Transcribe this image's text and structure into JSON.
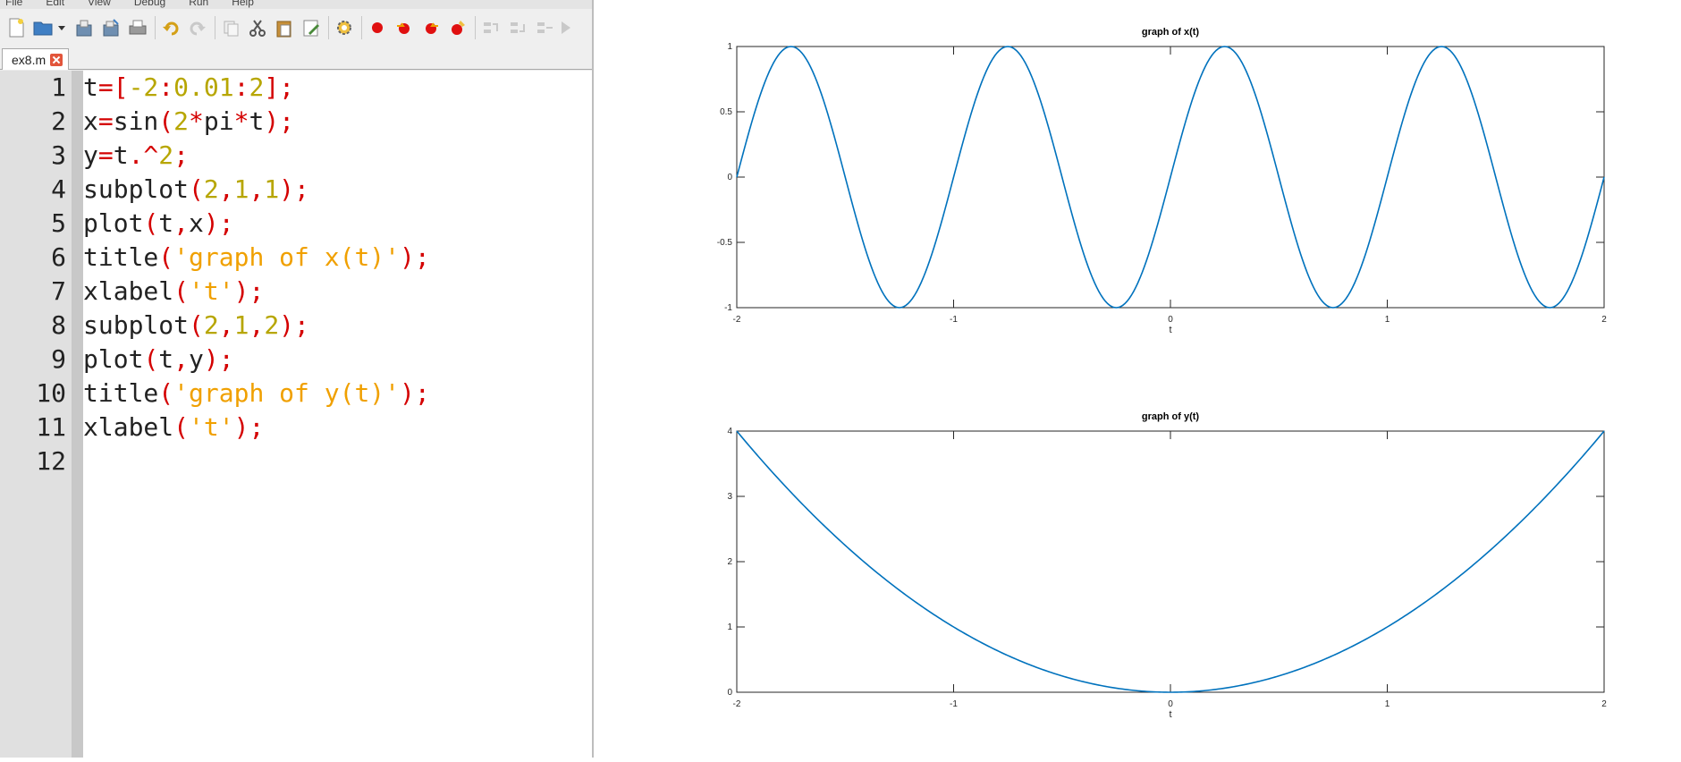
{
  "menubar": {
    "items": [
      "File",
      "Edit",
      "View",
      "Debug",
      "Run",
      "Help"
    ]
  },
  "toolbar": {
    "icons": [
      "new-file-icon",
      "open-folder-icon",
      "dropdown-arrow-icon",
      "save-icon",
      "save-as-icon",
      "print-icon",
      "undo-icon",
      "redo-icon",
      "copy-icon",
      "cut-icon",
      "paste-icon",
      "edit-icon",
      "settings-icon",
      "breakpoint-icon",
      "breakpoint-next-icon",
      "breakpoint-prev-icon",
      "clear-breakpoints-icon",
      "step-icon",
      "step-in-icon",
      "step-out-icon",
      "run-icon"
    ]
  },
  "tab": {
    "label": "ex8.m"
  },
  "code": {
    "lines": [
      [
        [
          "t",
          "id"
        ],
        [
          "=[",
          "op"
        ],
        [
          "-2",
          "num"
        ],
        [
          ":",
          "op"
        ],
        [
          "0.01",
          "num"
        ],
        [
          ":",
          "op"
        ],
        [
          "2",
          "num"
        ],
        [
          "];",
          "op"
        ]
      ],
      [
        [
          "x",
          "id"
        ],
        [
          "=",
          "op"
        ],
        [
          "sin",
          "id"
        ],
        [
          "(",
          "op"
        ],
        [
          "2",
          "num"
        ],
        [
          "*",
          "op"
        ],
        [
          "pi",
          "id"
        ],
        [
          "*",
          "op"
        ],
        [
          "t",
          "id"
        ],
        [
          ");",
          "op"
        ]
      ],
      [
        [
          "y",
          "id"
        ],
        [
          "=",
          "op"
        ],
        [
          "t",
          "id"
        ],
        [
          ".^",
          "op"
        ],
        [
          "2",
          "num"
        ],
        [
          ";",
          "op"
        ]
      ],
      [
        [
          "subplot",
          "id"
        ],
        [
          "(",
          "op"
        ],
        [
          "2",
          "num"
        ],
        [
          ",",
          "op"
        ],
        [
          "1",
          "num"
        ],
        [
          ",",
          "op"
        ],
        [
          "1",
          "num"
        ],
        [
          ");",
          "op"
        ]
      ],
      [
        [
          "plot",
          "id"
        ],
        [
          "(",
          "op"
        ],
        [
          "t",
          "id"
        ],
        [
          ",",
          "op"
        ],
        [
          "x",
          "id"
        ],
        [
          ");",
          "op"
        ]
      ],
      [
        [
          "title",
          "id"
        ],
        [
          "(",
          "op"
        ],
        [
          "'graph of x(t)'",
          "str"
        ],
        [
          ");",
          "op"
        ]
      ],
      [
        [
          "xlabel",
          "id"
        ],
        [
          "(",
          "op"
        ],
        [
          "'t'",
          "str"
        ],
        [
          ");",
          "op"
        ]
      ],
      [
        [
          "subplot",
          "id"
        ],
        [
          "(",
          "op"
        ],
        [
          "2",
          "num"
        ],
        [
          ",",
          "op"
        ],
        [
          "1",
          "num"
        ],
        [
          ",",
          "op"
        ],
        [
          "2",
          "num"
        ],
        [
          ");",
          "op"
        ]
      ],
      [
        [
          "plot",
          "id"
        ],
        [
          "(",
          "op"
        ],
        [
          "t",
          "id"
        ],
        [
          ",",
          "op"
        ],
        [
          "y",
          "id"
        ],
        [
          ");",
          "op"
        ]
      ],
      [
        [
          "title",
          "id"
        ],
        [
          "(",
          "op"
        ],
        [
          "'graph of y(t)'",
          "str"
        ],
        [
          ");",
          "op"
        ]
      ],
      [
        [
          "xlabel",
          "id"
        ],
        [
          "(",
          "op"
        ],
        [
          "'t'",
          "str"
        ],
        [
          ");",
          "op"
        ]
      ],
      []
    ],
    "line_numbers": [
      "1",
      "2",
      "3",
      "4",
      "5",
      "6",
      "7",
      "8",
      "9",
      "10",
      "11",
      "12"
    ]
  },
  "colors": {
    "line": "#0072bd",
    "operator": "#d40000",
    "number": "#b7a600",
    "string": "#f0a000"
  },
  "chart_data": [
    {
      "type": "line",
      "title": "graph of x(t)",
      "xlabel": "t",
      "ylabel": "",
      "xlim": [
        -2,
        2
      ],
      "ylim": [
        -1,
        1
      ],
      "xticks": [
        "-2",
        "-1",
        "0",
        "1",
        "2"
      ],
      "yticks": [
        "1",
        "0.5",
        "0",
        "-0.5",
        "-1"
      ],
      "function": "sin(2*pi*t)",
      "x_range": [
        -2,
        2,
        0.01
      ],
      "grid": false
    },
    {
      "type": "line",
      "title": "graph of y(t)",
      "xlabel": "t",
      "ylabel": "",
      "xlim": [
        -2,
        2
      ],
      "ylim": [
        0,
        4
      ],
      "xticks": [
        "-2",
        "-1",
        "0",
        "1",
        "2"
      ],
      "yticks": [
        "4",
        "3",
        "2",
        "1",
        "0"
      ],
      "function": "t.^2",
      "x_range": [
        -2,
        2,
        0.01
      ],
      "grid": false
    }
  ]
}
